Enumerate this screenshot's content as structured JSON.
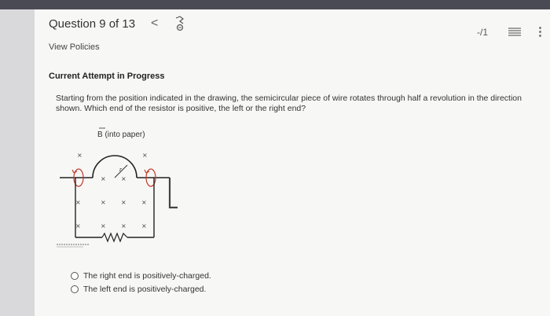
{
  "header": {
    "question_label": "Question 9 of 13",
    "prev_glyph": "<",
    "score": "-/1",
    "more_glyph": "⋮"
  },
  "links": {
    "view_policies": "View Policies"
  },
  "attempt_label": "Current Attempt in Progress",
  "question": {
    "text": "Starting from the position indicated in the drawing, the semicircular piece of wire rotates through half a revolution in the direction shown. Which end of the resistor is positive, the left or the right end?"
  },
  "figure": {
    "field_label": "B (into paper)",
    "radius_label": "r",
    "x_mark": "×"
  },
  "options": [
    {
      "label": "The right end is positively-charged."
    },
    {
      "label": "The left end is positively-charged."
    }
  ]
}
